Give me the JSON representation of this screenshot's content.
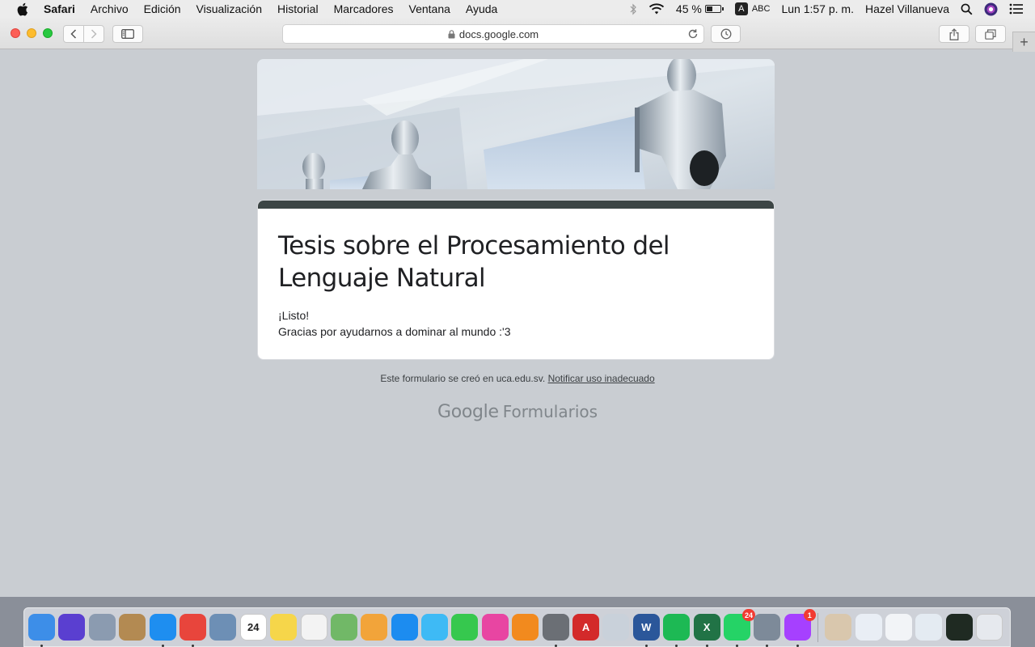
{
  "menubar": {
    "app_name": "Safari",
    "menus": [
      "Archivo",
      "Edición",
      "Visualización",
      "Historial",
      "Marcadores",
      "Ventana",
      "Ayuda"
    ],
    "battery_percent": "45 %",
    "battery_level": 0.45,
    "input_source_badge": "A",
    "input_source_label": "ABC",
    "clock": "Lun 1:57 p. m.",
    "user_name": "Hazel Villanueva"
  },
  "browser": {
    "address": "docs.google.com"
  },
  "form": {
    "title": "Tesis sobre el Procesamiento del Lenguaje Natural",
    "message_line1": "¡Listo!",
    "message_line2": "Gracias por ayudarnos a dominar al mundo :'3",
    "footer_text": "Este formulario se creó en uca.edu.sv.",
    "report_link": "Notificar uso inadecuado",
    "brand_google": "Google",
    "brand_product": "Formularios"
  },
  "colors": {
    "form_accent": "#3c4545",
    "page_background": "#c9cdd2",
    "card_background": "#ffffff"
  },
  "dock": {
    "items": [
      {
        "name": "finder-icon",
        "color": "#3d8ee8",
        "running": true
      },
      {
        "name": "siri-icon",
        "color": "#5a3fd0",
        "running": false
      },
      {
        "name": "launchpad-icon",
        "color": "#8b9bb0",
        "running": false
      },
      {
        "name": "contacts-icon",
        "color": "#b38a52",
        "running": false
      },
      {
        "name": "safari-icon",
        "color": "#1e8ef0",
        "running": true
      },
      {
        "name": "chrome-icon",
        "color": "#e8453c",
        "running": true
      },
      {
        "name": "preview-icon",
        "color": "#6d8fb5",
        "running": false
      },
      {
        "name": "calendar-icon",
        "color": "#ffffff",
        "label": "24",
        "running": false
      },
      {
        "name": "notes-icon",
        "color": "#f6d64a",
        "running": false
      },
      {
        "name": "reminders-icon",
        "color": "#f3f3f3",
        "running": false
      },
      {
        "name": "maps-icon",
        "color": "#71b867",
        "running": false
      },
      {
        "name": "photos-icon",
        "color": "#f2a43a",
        "running": false
      },
      {
        "name": "app-store-icon",
        "color": "#1c8cf0",
        "running": false
      },
      {
        "name": "messages-icon",
        "color": "#3ebaf5",
        "running": false
      },
      {
        "name": "facetime-icon",
        "color": "#36c84e",
        "running": false
      },
      {
        "name": "itunes-icon",
        "color": "#e845a2",
        "running": false
      },
      {
        "name": "books-icon",
        "color": "#f28a1e",
        "running": false
      },
      {
        "name": "system-preferences-icon",
        "color": "#6b6f75",
        "running": true
      },
      {
        "name": "autocad-icon",
        "color": "#d32a2a",
        "label": "A",
        "running": false
      },
      {
        "name": "files-icon",
        "color": "#c9d1da",
        "running": false
      },
      {
        "name": "word-icon",
        "color": "#2b579a",
        "label": "W",
        "running": true
      },
      {
        "name": "spotify-icon",
        "color": "#1db954",
        "running": true
      },
      {
        "name": "excel-icon",
        "color": "#217346",
        "label": "X",
        "running": true
      },
      {
        "name": "whatsapp-icon",
        "color": "#25d366",
        "badge": "24",
        "running": true
      },
      {
        "name": "image-capture-icon",
        "color": "#7d8a99",
        "running": true
      },
      {
        "name": "messenger-icon",
        "color": "#a640ff",
        "badge": "1",
        "running": true
      }
    ],
    "recent": [
      {
        "name": "recent-window-1-icon",
        "color": "#d9c7ad"
      },
      {
        "name": "recent-window-2-icon",
        "color": "#e9eef5"
      },
      {
        "name": "recent-window-3-icon",
        "color": "#f2f4f7"
      },
      {
        "name": "recent-window-4-icon",
        "color": "#e4ebf2"
      },
      {
        "name": "recent-window-5-icon",
        "color": "#1f2a22"
      },
      {
        "name": "trash-icon",
        "color": "#e6e9ee"
      }
    ]
  }
}
